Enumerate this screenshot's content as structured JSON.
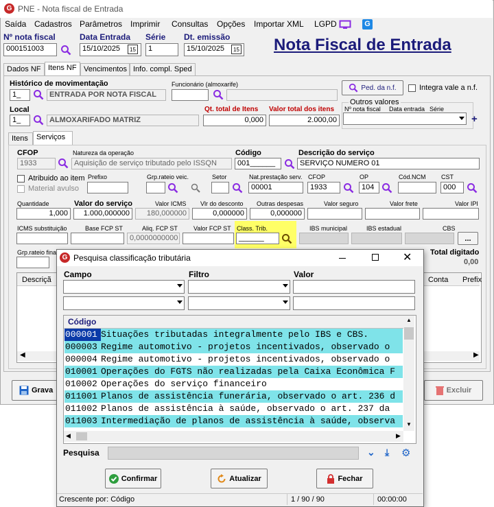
{
  "window": {
    "title": "PNE - Nota fiscal de Entrada"
  },
  "menu": [
    "Saída",
    "Cadastros",
    "Parâmetros",
    "Imprimir",
    "Consultas",
    "Opções",
    "Importar XML",
    "LGPD"
  ],
  "header": {
    "nota_label": "Nº nota fiscal",
    "nota_value": "000151003",
    "data_entrada_label": "Data Entrada",
    "data_entrada_value": "15/10/2025",
    "serie_label": "Série",
    "serie_value": "1",
    "emissao_label": "Dt. emissão",
    "emissao_value": "15/10/2025",
    "big_title": "Nota Fiscal de Entrada"
  },
  "tabs": [
    "Dados NF",
    "Itens NF",
    "Vencimentos",
    "Info. compl. Sped"
  ],
  "itens_nf": {
    "historico_label": "Histórico de movimentação",
    "historico_code": "1_",
    "historico_desc": "ENTRADA POR NOTA FISCAL",
    "funcionario_label": "Funcionário (almoxarife)",
    "local_label": "Local",
    "local_code": "1_",
    "local_desc": "ALMOXARIFADO MATRIZ",
    "qt_total_label": "Qt. total de Itens",
    "qt_total_value": "0,000",
    "valor_total_label": "Valor total dos itens",
    "valor_total_value": "2.000,00",
    "ped_button": "Ped. da n.f.",
    "integra_label": "Integra vale a n.f.",
    "outros_label": "Outros valores",
    "outros_cols": [
      "Nº nota fiscal",
      "Data entrada",
      "Série"
    ]
  },
  "subtabs": [
    "Itens",
    "Serviços"
  ],
  "servicos": {
    "cfop_label": "CFOP",
    "cfop_value": "1933",
    "natureza_label": "Natureza da operação",
    "natureza_value": "Aquisição de serviço tributado pelo ISSQN",
    "codigo_label": "Código",
    "codigo_value": "001______",
    "descricao_label": "Descrição do serviço",
    "descricao_value": "SERVIÇO NUMERO 01",
    "atribuido_label": "Atribuido ao item",
    "material_label": "Material avulso",
    "prefixo_label": "Prefixo",
    "grp_rateio_label": "Grp.rateio veic.",
    "setor_label": "Setor",
    "nat_prest_label": "Nat.prestação serv.",
    "nat_prest_value": "00001",
    "cfop2_label": "CFOP",
    "cfop2_value": "1933",
    "op_label": "OP",
    "op_value": "104",
    "cod_ncm_label": "Cód.NCM",
    "cst_label": "CST",
    "cst_value": "000",
    "quantidade_label": "Quantidade",
    "quantidade_value": "1,000",
    "valor_servico_label": "Valor do serviço",
    "valor_servico_value": "1.000,000000",
    "valor_icms_label": "Valor ICMS",
    "valor_icms_value": "180,000000",
    "vlr_desconto_label": "Vlr do desconto",
    "vlr_desconto_value": "0,000000",
    "outras_desp_label": "Outras despesas",
    "outras_desp_value": "0,000000",
    "valor_seguro_label": "Valor seguro",
    "valor_frete_label": "Valor frete",
    "valor_ipi_label": "Valor IPI",
    "icms_subst_label": "ICMS substituição",
    "base_fcp_label": "Base FCP ST",
    "aliq_fcp_label": "Aliq. FCP ST",
    "aliq_fcp_value": "0,0000000000",
    "valor_fcp_label": "Valor FCP ST",
    "class_trib_label": "Class. Trib.",
    "class_trib_value": "______",
    "ibs_mun_label": "IBS municipal",
    "ibs_est_label": "IBS estadual",
    "cbs_label": "CBS",
    "cbs_button": "...",
    "grp_rateio_fina_label": "Grp.rateio fina",
    "total_digitado_label": "Total digitado",
    "total_digitado_value": "0,00",
    "grid_cols": [
      "Descriçã",
      "Conta",
      "Prefix"
    ]
  },
  "bottom_buttons": {
    "gravar": "Grava",
    "excluir": "Excluir"
  },
  "dialog": {
    "title": "Pesquisa classificação tributária",
    "campo_label": "Campo",
    "filtro_label": "Filtro",
    "valor_label": "Valor",
    "col_codigo": "Código",
    "rows": [
      {
        "code": "000001",
        "text": "Situações tributadas integralmente pelo IBS e CBS."
      },
      {
        "code": "000003",
        "text": "Regime automotivo - projetos incentivados, observado o"
      },
      {
        "code": "000004",
        "text": "Regime automotivo - projetos incentivados, observado o"
      },
      {
        "code": "010001",
        "text": "Operações do FGTS não realizadas pela Caixa Econômica F"
      },
      {
        "code": "010002",
        "text": "Operações do serviço financeiro"
      },
      {
        "code": "011001",
        "text": "Planos de assistência funerária, observado o art. 236 d"
      },
      {
        "code": "011002",
        "text": "Planos de assistência à saúde, observado o art. 237 da"
      },
      {
        "code": "011003",
        "text": "Intermediação de planos de assistência à saúde, observa"
      }
    ],
    "pesquisa_label": "Pesquisa",
    "confirmar": "Confirmar",
    "atualizar": "Atualizar",
    "fechar": "Fechar",
    "status_order": "Crescente por: Código",
    "status_count": "1 / 90 / 90",
    "status_time": "00:00:00"
  },
  "colors": {
    "accent_blue": "#0a3aa8",
    "row_cyan": "#7fe3e9",
    "title_navy": "#1b1b7a",
    "label_red": "#c00000",
    "highlight_yellow": "#ffff66"
  }
}
